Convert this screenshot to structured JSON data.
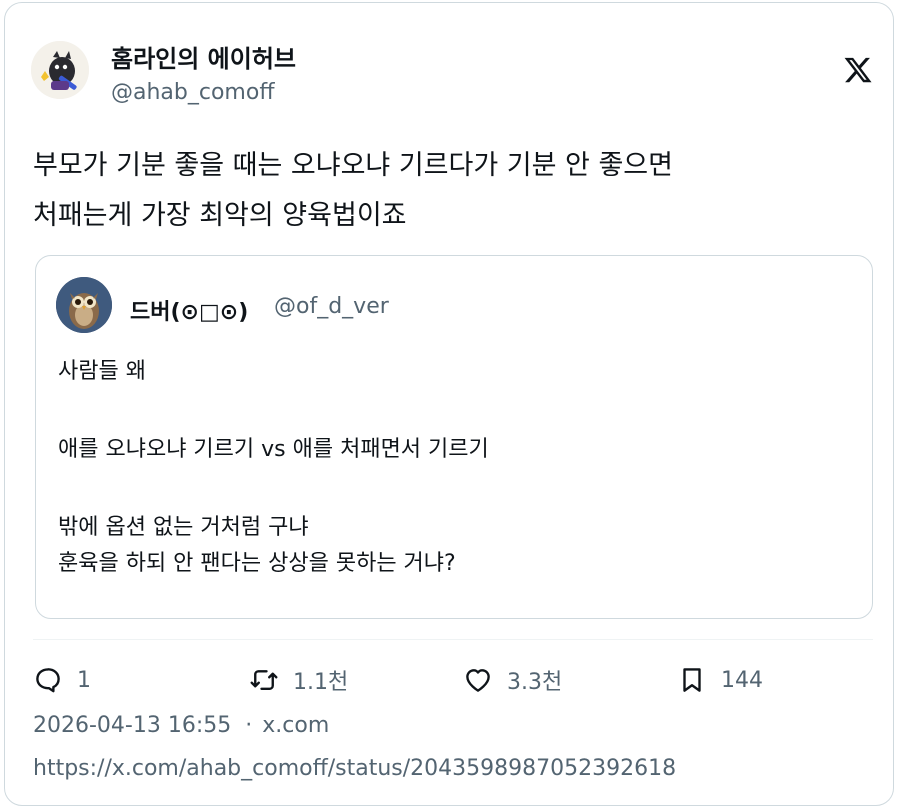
{
  "author": {
    "name": "홈라인의 에이허브",
    "handle": "@ahab_comoff",
    "avatar_icon": "avatar-creature-guitar-icon"
  },
  "platform_icon": "x-logo-icon",
  "tweet": {
    "lines": [
      "부모가 기분 좋을 때는 오냐오냐 기르다가 기분 안 좋으면",
      "처패는게 가장 최악의 양육법이죠"
    ]
  },
  "quote": {
    "name": "드버(⊙□⊙)",
    "handle": "@of_d_ver",
    "avatar_icon": "avatar-owl-icon",
    "lines": [
      "사람들 왜",
      "애를 오냐오냐 기르기 vs 애를 처패면서 기르기",
      "밖에 옵션 없는 거처럼 구냐",
      "훈육을 하되 안 팬다는 상상을 못하는 거냐?"
    ]
  },
  "actions": {
    "reply": {
      "icon": "reply-icon",
      "count": "1"
    },
    "retweet": {
      "icon": "retweet-icon",
      "count": "1.1천"
    },
    "like": {
      "icon": "heart-icon",
      "count": "3.3천"
    },
    "bookmark": {
      "icon": "bookmark-icon",
      "count": "144"
    }
  },
  "meta": {
    "timestamp": "2026-04-13 16:55",
    "separator": "·",
    "source": "x.com"
  },
  "url": "https://x.com/ahab_comoff/status/2043598987052392618",
  "colors": {
    "text": "#0f1419",
    "secondary": "#536471",
    "border": "#cfd9de"
  }
}
